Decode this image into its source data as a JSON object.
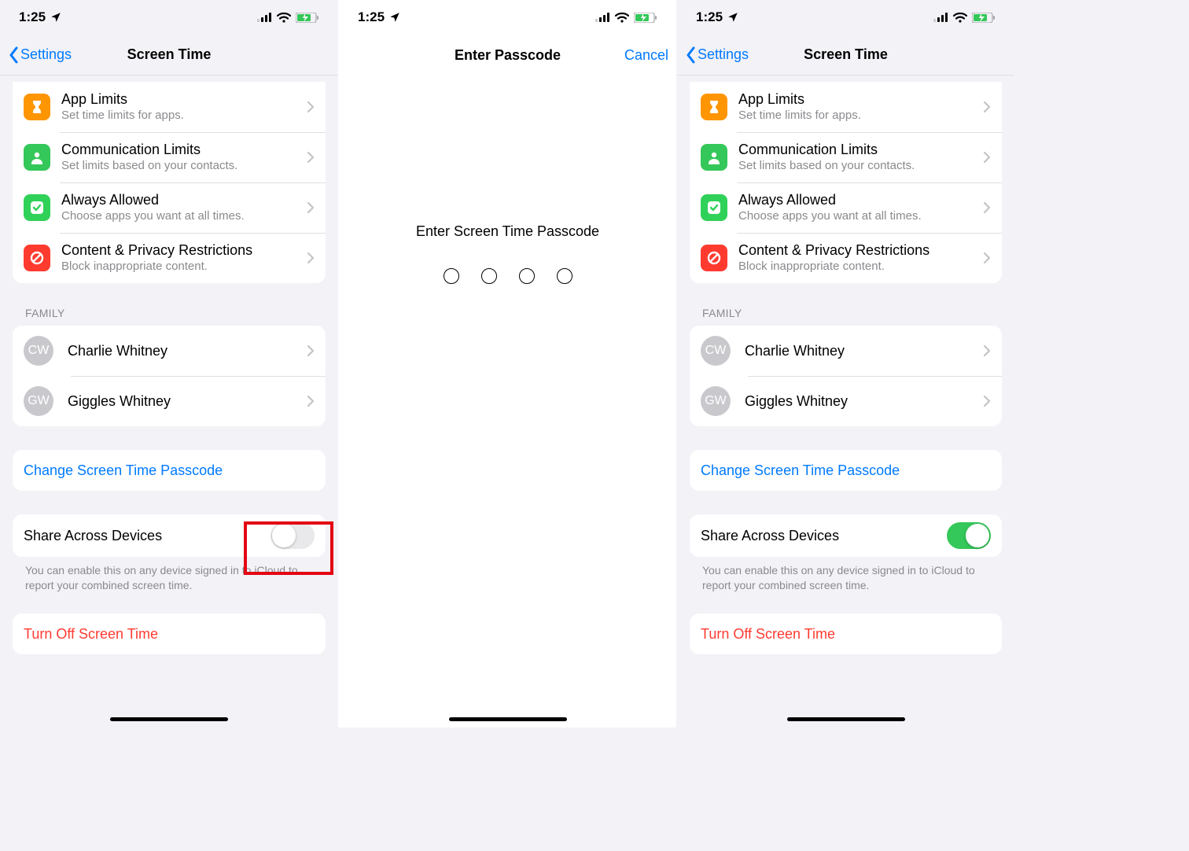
{
  "statusbar": {
    "time": "1:25"
  },
  "nav": {
    "back_label": "Settings",
    "title": "Screen Time",
    "passcode_title": "Enter Passcode",
    "cancel": "Cancel"
  },
  "rows": {
    "app_limits": {
      "title": "App Limits",
      "subtitle": "Set time limits for apps."
    },
    "comm_limits": {
      "title": "Communication Limits",
      "subtitle": "Set limits based on your contacts."
    },
    "always_allowed": {
      "title": "Always Allowed",
      "subtitle": "Choose apps you want at all times."
    },
    "content_privacy": {
      "title": "Content & Privacy Restrictions",
      "subtitle": "Block inappropriate content."
    }
  },
  "family": {
    "header": "Family",
    "members": [
      {
        "initials": "CW",
        "name": "Charlie Whitney"
      },
      {
        "initials": "GW",
        "name": "Giggles Whitney"
      }
    ]
  },
  "actions": {
    "change_passcode": "Change Screen Time Passcode",
    "share_across": "Share Across Devices",
    "share_note": "You can enable this on any device signed in to iCloud to report your combined screen time.",
    "turn_off": "Turn Off Screen Time"
  },
  "passcode": {
    "prompt": "Enter Screen Time Passcode"
  },
  "screens": {
    "left_toggle_on": false,
    "right_toggle_on": true
  },
  "colors": {
    "link": "#007aff",
    "destructive": "#ff3b30",
    "toggle_on": "#34c759"
  }
}
